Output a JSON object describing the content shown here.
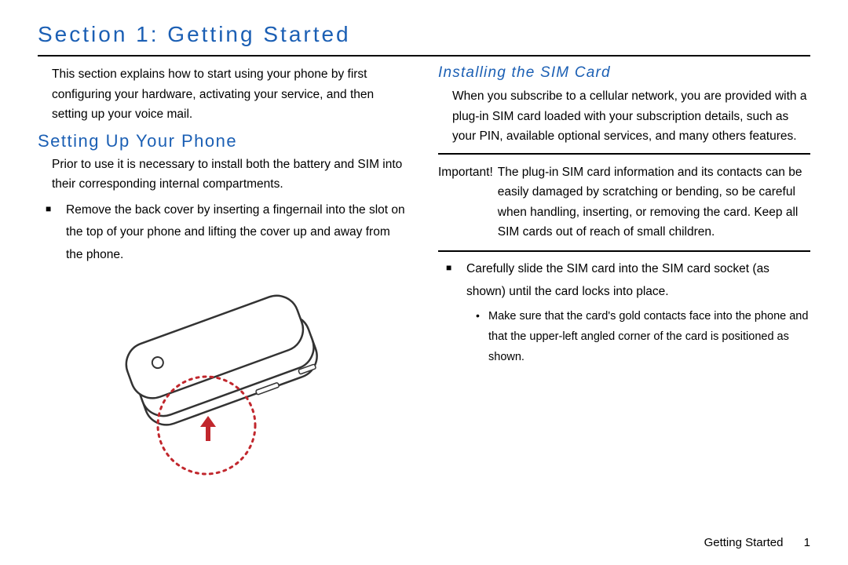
{
  "title": "Section 1: Getting Started",
  "left": {
    "intro": "This section explains how to start using your phone by first configuring your hardware, activating your service, and then setting up your voice mail.",
    "h2": "Setting Up Your Phone",
    "para1": "Prior to use it is necessary to install both the battery and SIM into their corresponding internal compartments.",
    "bullet1": "Remove the back cover by inserting a fingernail into the slot on the top of your phone and lifting the cover up and away from the phone."
  },
  "right": {
    "h3": "Installing the SIM Card",
    "para1": "When you subscribe to a cellular network, you are provided with a plug-in SIM card loaded with your subscription details, such as your PIN, available optional services, and many others features.",
    "important_label": "Important!",
    "important_body": "The plug-in SIM card information and its contacts can be easily damaged by scratching or bending, so be careful when handling, inserting, or removing the card. Keep all SIM cards out of reach of small children.",
    "bullet1": "Carefully slide the SIM card into the SIM card socket (as shown) until the card locks into place.",
    "sub1": "Make sure that the card's gold contacts face into the phone and that the upper-left angled corner of the card is positioned as shown."
  },
  "footer": {
    "label": "Getting Started",
    "page": "1"
  }
}
